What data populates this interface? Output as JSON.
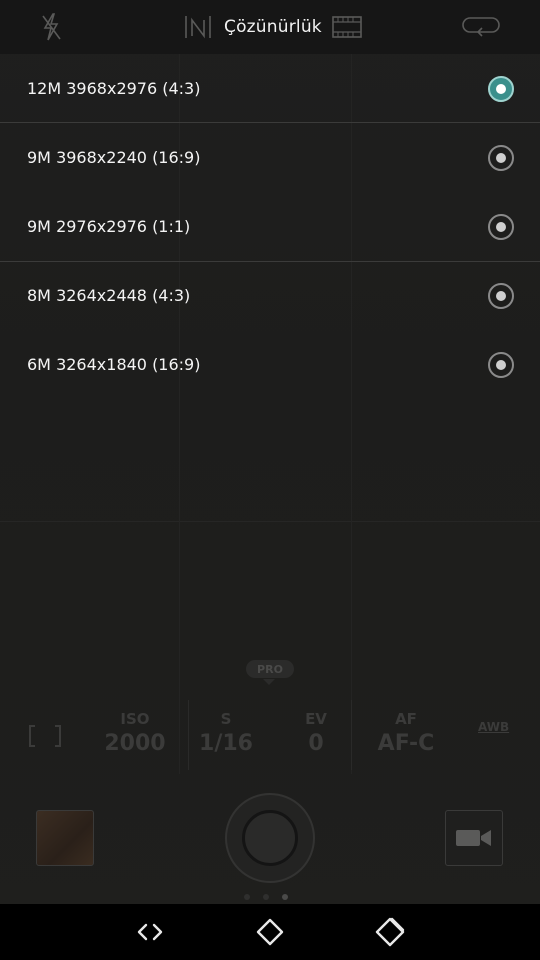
{
  "topbar": {
    "title": "Çözünürlük",
    "icons": [
      "flash-off-icon",
      "hdr-icon",
      "film-icon",
      "camera-switch-icon"
    ]
  },
  "resolutions": [
    {
      "label": "12M 3968x2976 (4:3)",
      "selected": true
    },
    {
      "label": "9M 3968x2240 (16:9)",
      "selected": false
    },
    {
      "label": "9M 2976x2976 (1:1)",
      "selected": false
    },
    {
      "label": "8M 3264x2448 (4:3)",
      "selected": false
    },
    {
      "label": "6M 3264x1840 (16:9)",
      "selected": false
    }
  ],
  "pro": {
    "badge": "PRO",
    "params": {
      "iso": {
        "key": "ISO",
        "value": "2000"
      },
      "s": {
        "key": "S",
        "value": "1/16"
      },
      "ev": {
        "key": "EV",
        "value": "0"
      },
      "af": {
        "key": "AF",
        "value": "AF-C"
      },
      "awb": "AWB"
    }
  },
  "bottom": {
    "pages": 3,
    "active_page": 3
  },
  "colors": {
    "selected_radio": "#3a8f8c",
    "background": "#1c1c1b"
  }
}
